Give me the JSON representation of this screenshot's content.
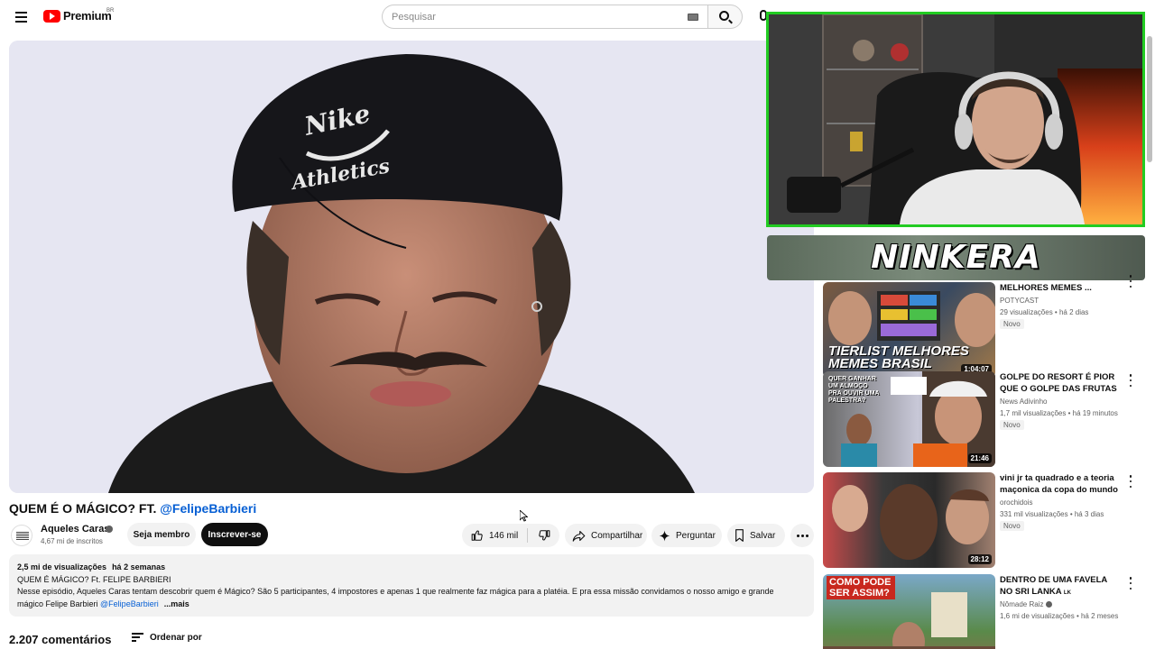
{
  "header": {
    "logo_text": "Premium",
    "country": "BR",
    "search_placeholder": "Pesquisar"
  },
  "video": {
    "title_main": "QUEM É O MÁGICO? FT. ",
    "title_mention": "@FelipeBarbieri",
    "channel": "Aqueles Caras",
    "subscribers": "4,67 mi de inscritos",
    "member_label": "Seja membro",
    "subscribe_label": "Inscrever-se",
    "likes": "146 mil",
    "share_label": "Compartilhar",
    "ask_label": "Perguntar",
    "save_label": "Salvar"
  },
  "description": {
    "views": "2,5 mi de visualizações",
    "date": "há 2 semanas",
    "line1": "QUEM É MÁGICO? Ft. FELIPE BARBIERI",
    "line2": "Nesse episódio, Aqueles Caras tentam descobrir quem é Mágico? São 5 participantes, 4 impostores e apenas 1 que realmente faz mágica para a platéia. E pra essa missão convidamos o nosso amigo e grande",
    "line3": "mágico Felipe Barbieri ",
    "mention": "@FelipeBarbieri",
    "more": "...mais"
  },
  "comments": {
    "count": "2.207 comentários",
    "sort_label": "Ordenar por"
  },
  "overlay": {
    "streamer_name": "NINKERA"
  },
  "recommendations": [
    {
      "title": "MELHORES MEMES ...",
      "channel": "POTYCAST",
      "views": "29 visualizações",
      "age": "há 2 dias",
      "badge": "Novo",
      "duration": "1:04:07",
      "thumb_text": "TIERLIST MELHORES MEMES BRASIL"
    },
    {
      "title": "GOLPE DO RESORT É PIOR QUE O GOLPE DAS FRUTAS",
      "channel": "News Adivinho",
      "views": "1,7 mil visualizações",
      "age": "há 19 minutos",
      "badge": "Novo",
      "duration": "21:46",
      "thumb_text": "QUER GANHAR UM ALMOÇO PRA OUVIR UMA PALESTRA?"
    },
    {
      "title": "vini jr ta quadrado e a teoria maçonica da copa do mundo",
      "channel": "orochidois",
      "views": "331 mil visualizações",
      "age": "há 3 dias",
      "badge": "Novo",
      "duration": "28:12",
      "thumb_text": ""
    },
    {
      "title": "DENTRO DE UMA FAVELA NO SRI LANKA",
      "title_suffix": "LK",
      "channel": "Nômade Raiz",
      "views": "1,6 mi de visualizações",
      "age": "há 2 meses",
      "badge": "",
      "duration": "",
      "thumb_text": "COMO PODE SER ASSIM?"
    }
  ],
  "colors": {
    "brand_red": "#ff0000",
    "link_blue": "#065fd4",
    "webcam_border": "#22cc22"
  }
}
